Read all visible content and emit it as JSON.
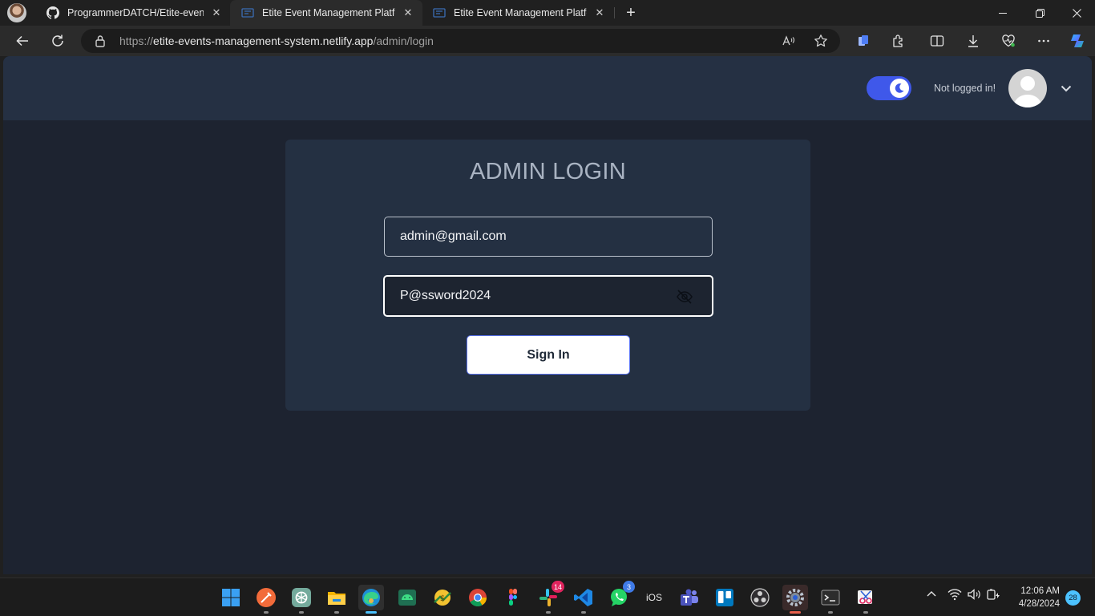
{
  "browser": {
    "tabs": [
      {
        "title": "ProgrammerDATCH/Etite-event-r",
        "favicon": "github-icon",
        "active": false
      },
      {
        "title": "Etite Event Management Platform",
        "favicon": "site-icon",
        "active": true
      },
      {
        "title": "Etite Event Management Platform",
        "favicon": "site-icon",
        "active": false
      }
    ],
    "url": {
      "scheme": "https://",
      "host": "etite-events-management-system.netlify.app",
      "path": "/admin/login"
    },
    "colors": {
      "frame": "#202020",
      "toolbar": "#2b2b2b",
      "accent": "#4cc2ff"
    }
  },
  "site": {
    "header": {
      "theme_toggle": {
        "state": "dark",
        "icon": "moon-icon",
        "color": "#3f58ea"
      },
      "login_status": "Not logged in!",
      "avatar": "user-avatar-icon"
    },
    "login": {
      "title": "ADMIN LOGIN",
      "email": {
        "value": "admin@gmail.com"
      },
      "password": {
        "value": "P@ssword2024",
        "visibility_icon": "eye-off-icon"
      },
      "submit_label": "Sign In"
    },
    "colors": {
      "background": "#1d2330",
      "header": "#253043",
      "card": "#243042"
    }
  },
  "taskbar": {
    "apps": [
      {
        "name": "start-icon"
      },
      {
        "name": "postman-icon"
      },
      {
        "name": "chatgpt-icon"
      },
      {
        "name": "file-explorer-icon"
      },
      {
        "name": "edge-icon",
        "active": true
      },
      {
        "name": "android-studio-icon"
      },
      {
        "name": "money-app-icon"
      },
      {
        "name": "chrome-icon"
      },
      {
        "name": "figma-icon"
      },
      {
        "name": "slack-icon",
        "badge": "14"
      },
      {
        "name": "vscode-icon"
      },
      {
        "name": "whatsapp-icon",
        "badge": "3"
      },
      {
        "name": "ios-icon",
        "label": "iOS"
      },
      {
        "name": "teams-icon"
      },
      {
        "name": "trello-icon"
      },
      {
        "name": "obs-icon"
      },
      {
        "name": "settings-icon"
      },
      {
        "name": "terminal-icon"
      },
      {
        "name": "snipping-tool-icon"
      }
    ],
    "clock": {
      "time": "12:06 AM",
      "date": "4/28/2024"
    },
    "notification_count": "28"
  }
}
